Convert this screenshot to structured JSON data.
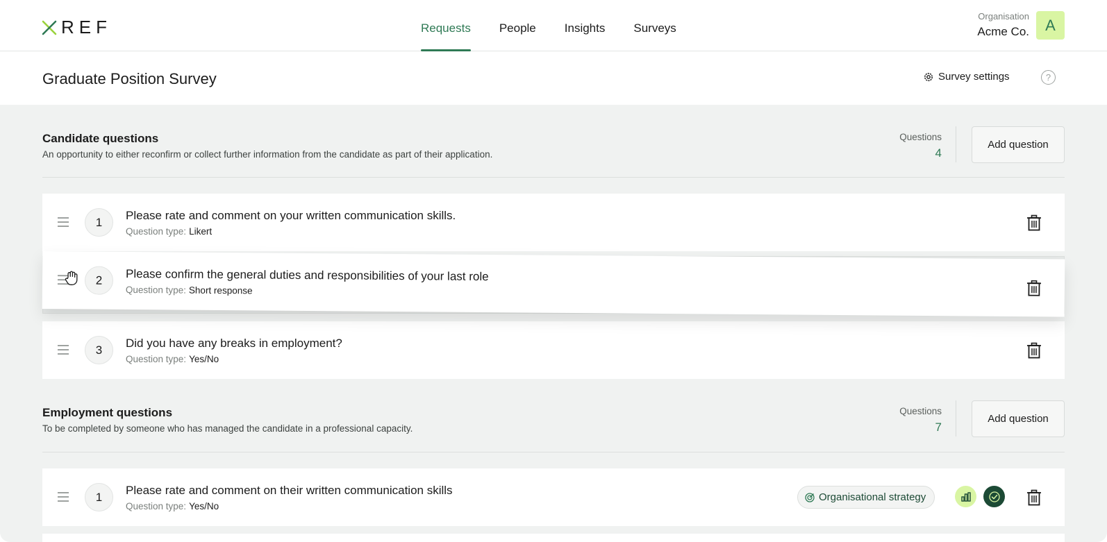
{
  "app": {
    "logo_text": "REF"
  },
  "nav": {
    "items": [
      {
        "label": "Requests",
        "active": true
      },
      {
        "label": "People",
        "active": false
      },
      {
        "label": "Insights",
        "active": false
      },
      {
        "label": "Surveys",
        "active": false
      }
    ]
  },
  "org": {
    "label": "Organisation",
    "name": "Acme Co.",
    "avatar_initial": "A"
  },
  "survey": {
    "title": "Graduate Position Survey",
    "settings_label": "Survey settings",
    "help_glyph": "?"
  },
  "candidate": {
    "title": "Candidate questions",
    "description": "An opportunity to either reconfirm or collect further information from the candidate as part of their application.",
    "count_label": "Questions",
    "count": "4",
    "add_label": "Add question",
    "type_prefix": "Question type:",
    "questions": [
      {
        "number": "1",
        "text": "Please rate and comment on your written communication skills.",
        "type": "Likert"
      },
      {
        "number": "2",
        "text": "Please confirm the general duties and responsibilities of your last role",
        "type": "Short response"
      },
      {
        "number": "3",
        "text": "Did you have any breaks in employment?",
        "type": "Yes/No"
      }
    ]
  },
  "employment": {
    "title": "Employment questions",
    "description": "To be completed by someone who has managed the candidate in a professional capacity.",
    "count_label": "Questions",
    "count": "7",
    "add_label": "Add question",
    "type_prefix": "Question type:",
    "questions": [
      {
        "number": "1",
        "text": "Please rate and comment on their written communication skills",
        "type": "Yes/No",
        "tag": "Organisational strategy"
      }
    ]
  },
  "colors": {
    "accent": "#2f7a55",
    "lime": "#d9f5a3",
    "dark_green": "#1c4a35",
    "background": "#f0f2f1"
  },
  "icons": [
    "x-logo-icon",
    "settings-gear-icon",
    "help-icon",
    "drag-handle-icon",
    "grab-hand-cursor-icon",
    "trash-icon",
    "target-icon",
    "bar-chart-icon",
    "check-badge-icon"
  ]
}
